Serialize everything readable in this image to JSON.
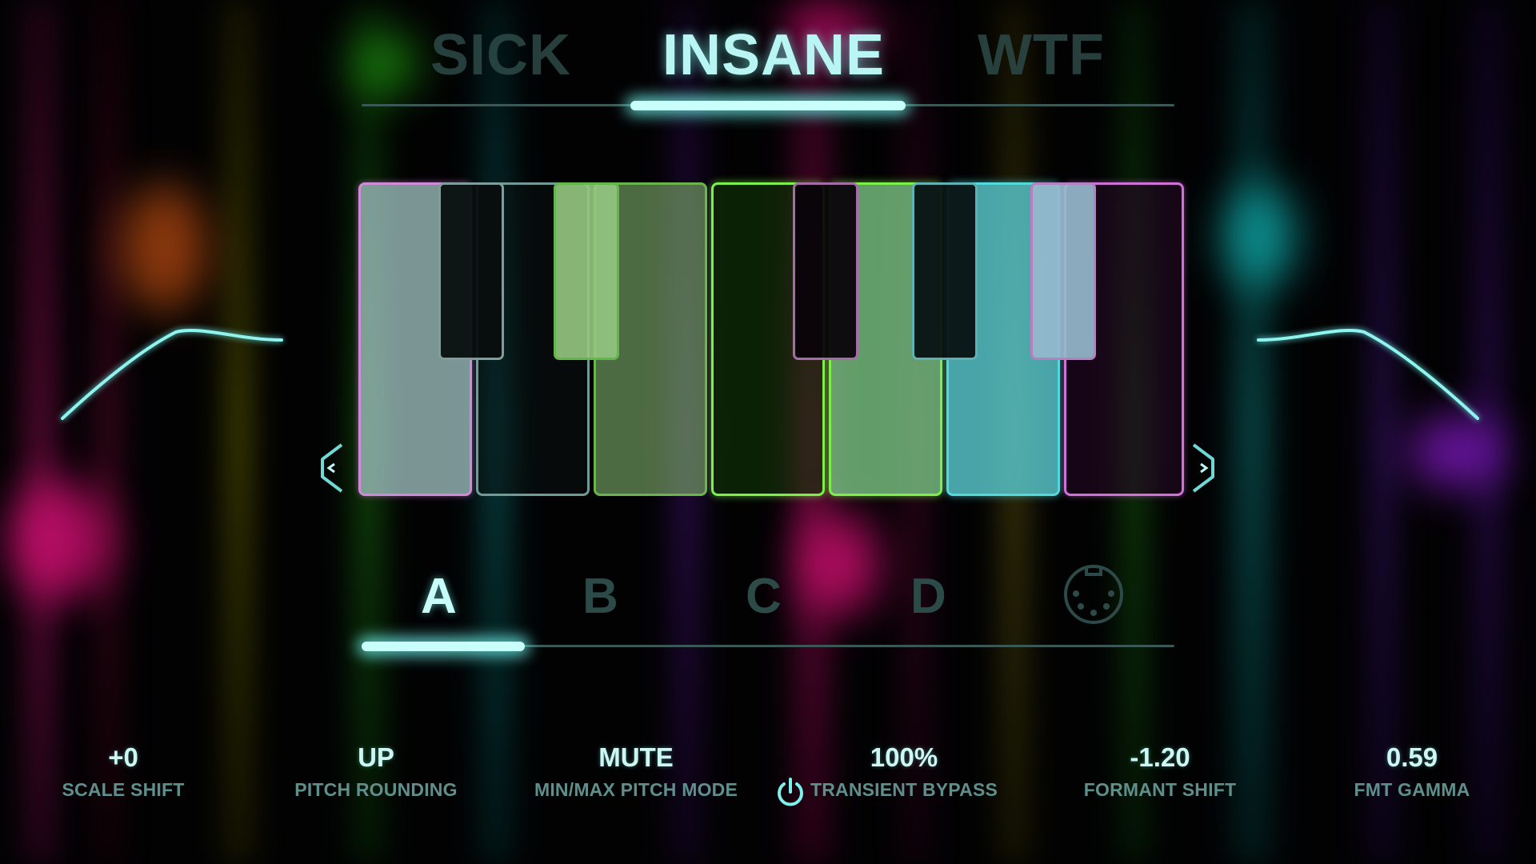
{
  "colors": {
    "accent": "#7ef0ea",
    "accent_glow": "#c9fffb",
    "inactive_text": "#2d4a48",
    "label_text": "#5f8f8c",
    "value_text": "#cdf7f3",
    "white_key_fill": "#9ec9c8",
    "pink_outline": "#e27fe9",
    "green_outline": "#7cf04a",
    "cyan_outline": "#54d8db"
  },
  "mode_tabs": [
    {
      "label": "SICK",
      "active": false
    },
    {
      "label": "INSANE",
      "active": true
    },
    {
      "label": "WTF",
      "active": false
    }
  ],
  "keyboard": {
    "nav_prev_icon": "chevron-left-icon",
    "nav_next_icon": "chevron-right-icon",
    "white_keys": [
      {
        "name": "C",
        "state": "on",
        "color": "pink"
      },
      {
        "name": "D",
        "state": "off",
        "color": "grey"
      },
      {
        "name": "E",
        "state": "off",
        "color": "green"
      },
      {
        "name": "F",
        "state": "on",
        "color": "green"
      },
      {
        "name": "G",
        "state": "on",
        "color": "cyan"
      },
      {
        "name": "A",
        "state": "off",
        "color": "grey"
      },
      {
        "name": "B",
        "state": "off",
        "color": "pink"
      }
    ],
    "black_keys": [
      {
        "name": "C#",
        "state": "off",
        "color": "grey"
      },
      {
        "name": "D#",
        "state": "on",
        "color": "green"
      },
      {
        "name": "F#",
        "state": "off",
        "color": "pink"
      },
      {
        "name": "G#",
        "state": "off",
        "color": "cyan"
      },
      {
        "name": "A#",
        "state": "on",
        "color": "pink"
      }
    ]
  },
  "letter_tabs": [
    {
      "label": "A",
      "active": true
    },
    {
      "label": "B",
      "active": false
    },
    {
      "label": "C",
      "active": false
    },
    {
      "label": "D",
      "active": false
    }
  ],
  "midi_icon": "midi-icon",
  "params": [
    {
      "value": "+0",
      "label": "SCALE SHIFT"
    },
    {
      "value": "UP",
      "label": "PITCH ROUNDING"
    },
    {
      "value": "MUTE",
      "label": "MIN/MAX PITCH MODE"
    },
    {
      "value": "100%",
      "label": "TRANSIENT BYPASS",
      "icon": "power-icon"
    },
    {
      "value": "-1.20",
      "label": "FORMANT SHIFT"
    },
    {
      "value": "0.59",
      "label": "FMT GAMMA"
    }
  ]
}
